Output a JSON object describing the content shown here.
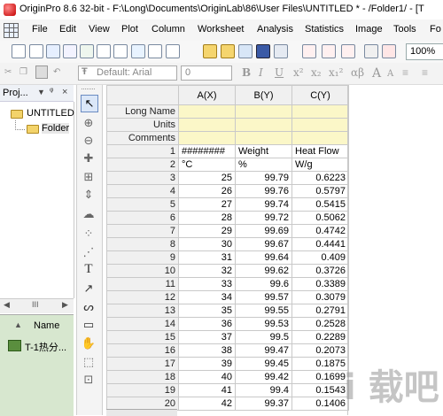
{
  "window": {
    "title": "OriginPro 8.6 32-bit - F:\\Long\\Documents\\OriginLab\\86\\User Files\\UNTITLED * - /Folder1/ - [T"
  },
  "menu": {
    "items": [
      "File",
      "Edit",
      "View",
      "Plot",
      "Column",
      "Worksheet",
      "Analysis",
      "Statistics",
      "Image",
      "Tools",
      "Fo"
    ]
  },
  "toolbar": {
    "zoom": "100%"
  },
  "format_toolbar": {
    "font": "Default: Arial",
    "size": "0",
    "buttons": [
      "B",
      "I",
      "U",
      "x²",
      "x₂",
      "x₁²",
      "αβ",
      "A",
      "A"
    ]
  },
  "project": {
    "header": "Proj...",
    "tree": [
      "UNTITLED",
      "Folder"
    ],
    "list_column": "Name",
    "list_items": [
      "T-1热分..."
    ]
  },
  "sheet": {
    "col_headers": [
      "A(X)",
      "B(Y)",
      "C(Y)"
    ],
    "meta_rows": [
      "Long Name",
      "Units",
      "Comments"
    ],
    "rows": [
      {
        "n": "1",
        "a": "########",
        "b": "Weight",
        "c": "Heat Flow"
      },
      {
        "n": "2",
        "a": "°C",
        "b": "%",
        "c": "W/g"
      },
      {
        "n": "3",
        "a": "25",
        "b": "99.79",
        "c": "0.6223"
      },
      {
        "n": "4",
        "a": "26",
        "b": "99.76",
        "c": "0.5797"
      },
      {
        "n": "5",
        "a": "27",
        "b": "99.74",
        "c": "0.5415"
      },
      {
        "n": "6",
        "a": "28",
        "b": "99.72",
        "c": "0.5062"
      },
      {
        "n": "7",
        "a": "29",
        "b": "99.69",
        "c": "0.4742"
      },
      {
        "n": "8",
        "a": "30",
        "b": "99.67",
        "c": "0.4441"
      },
      {
        "n": "9",
        "a": "31",
        "b": "99.64",
        "c": "0.409"
      },
      {
        "n": "10",
        "a": "32",
        "b": "99.62",
        "c": "0.3726"
      },
      {
        "n": "11",
        "a": "33",
        "b": "99.6",
        "c": "0.3389"
      },
      {
        "n": "12",
        "a": "34",
        "b": "99.57",
        "c": "0.3079"
      },
      {
        "n": "13",
        "a": "35",
        "b": "99.55",
        "c": "0.2791"
      },
      {
        "n": "14",
        "a": "36",
        "b": "99.53",
        "c": "0.2528"
      },
      {
        "n": "15",
        "a": "37",
        "b": "99.5",
        "c": "0.2289"
      },
      {
        "n": "16",
        "a": "38",
        "b": "99.47",
        "c": "0.2073"
      },
      {
        "n": "17",
        "a": "39",
        "b": "99.45",
        "c": "0.1875"
      },
      {
        "n": "18",
        "a": "40",
        "b": "99.42",
        "c": "0.1699"
      },
      {
        "n": "19",
        "a": "41",
        "b": "99.4",
        "c": "0.1543"
      },
      {
        "n": "20",
        "a": "42",
        "b": "99.37",
        "c": "0.1406"
      }
    ]
  },
  "watermark": "i 载吧"
}
